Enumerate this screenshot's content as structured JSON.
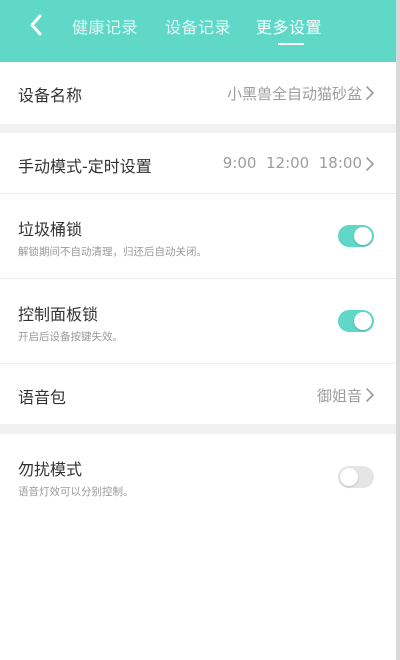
{
  "header": {
    "tabs": [
      {
        "label": "健康记录",
        "active": false
      },
      {
        "label": "设备记录",
        "active": false
      },
      {
        "label": "更多设置",
        "active": true
      }
    ],
    "accent_color": "#5fd8c8"
  },
  "settings": {
    "device_name": {
      "label": "设备名称",
      "value": "小黑兽全自动猫砂盆"
    },
    "manual_mode": {
      "label": "手动模式-定时设置",
      "value": "9:00  12:00  18:00"
    },
    "trash_lock": {
      "label": "垃圾桶锁",
      "description": "解锁期间不自动清理，归还后自动关闭。",
      "enabled": true
    },
    "panel_lock": {
      "label": "控制面板锁",
      "description": "开启后设备按键失效。",
      "enabled": true
    },
    "voice_pack": {
      "label": "语音包",
      "value": "御姐音"
    },
    "do_not_disturb": {
      "label": "勿扰模式",
      "description": "语音灯效可以分别控制。",
      "enabled": false
    }
  },
  "icons": {
    "back": "chevron-left-icon",
    "row_arrow": "chevron-right-icon"
  }
}
